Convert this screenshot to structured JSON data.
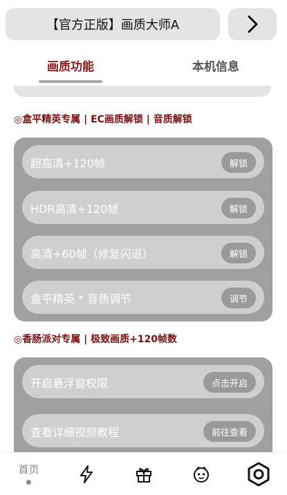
{
  "header": {
    "title": "【官方正版】画质大师A",
    "next_icon": "chevron-right-icon"
  },
  "tabs": [
    {
      "label": "画质功能",
      "active": true
    },
    {
      "label": "本机信息",
      "active": false
    }
  ],
  "section1": {
    "title": "◎盒平精英专属 | EC画质解锁 | 音质解锁",
    "rows": [
      {
        "label": "超高清+120帧",
        "action": "解锁"
      },
      {
        "label": "HDR高清+120帧",
        "action": "解锁"
      },
      {
        "label": "高清+60帧（修复闪退）",
        "action": "解锁"
      },
      {
        "label": "盒平精英 * 音质调节",
        "action": "调节"
      }
    ]
  },
  "section2": {
    "title": "◎香肠派对专属 | 极致画质+120帧数",
    "rows": [
      {
        "label": "开启悬浮窗权限",
        "action": "点击开启"
      },
      {
        "label": "查看详细视频教程",
        "action": "前往查看"
      }
    ]
  },
  "bottom_nav": {
    "home_label": "首页",
    "items": [
      "home",
      "lightning-icon",
      "gift-icon",
      "face-icon",
      "hexagon-settings-icon"
    ]
  },
  "colors": {
    "accent": "#8e1c1c",
    "panel": "#a0a0a0",
    "row": "#cfcfcf",
    "button": "#9a9a9a"
  }
}
